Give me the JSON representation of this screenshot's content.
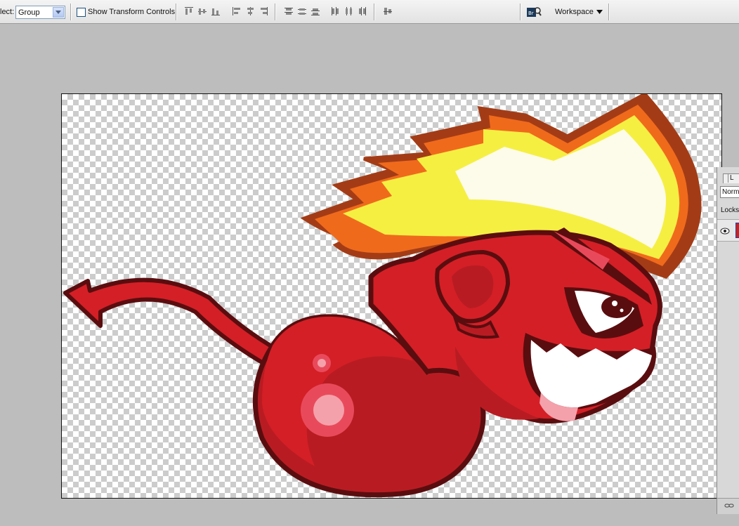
{
  "toolbar": {
    "select_label": "lect:",
    "select_value": "Group",
    "show_transform_label": "Show Transform Controls",
    "workspace_label": "Workspace"
  },
  "icons": [
    "align-top-edges-icon",
    "align-vertical-centers-icon",
    "align-bottom-edges-icon",
    "align-left-edges-icon",
    "align-horizontal-centers-icon",
    "align-right-edges-icon",
    "distribute-top-icon",
    "distribute-vertical-centers-icon",
    "distribute-bottom-icon",
    "distribute-left-icon",
    "distribute-horizontal-centers-icon",
    "distribute-right-icon",
    "auto-align-icon",
    "bridge-icon"
  ],
  "layers_panel": {
    "tab_label": "L",
    "blend_mode": "Norm",
    "locks_label": "Locks:"
  },
  "colors": {
    "devil_red": "#d41f26",
    "dark_red": "#9c1a1d",
    "outline": "#5a0d0f",
    "hair_yellow": "#f5ef42",
    "hair_cream": "#fdfbe9",
    "flame_orange": "#f06a1c"
  }
}
